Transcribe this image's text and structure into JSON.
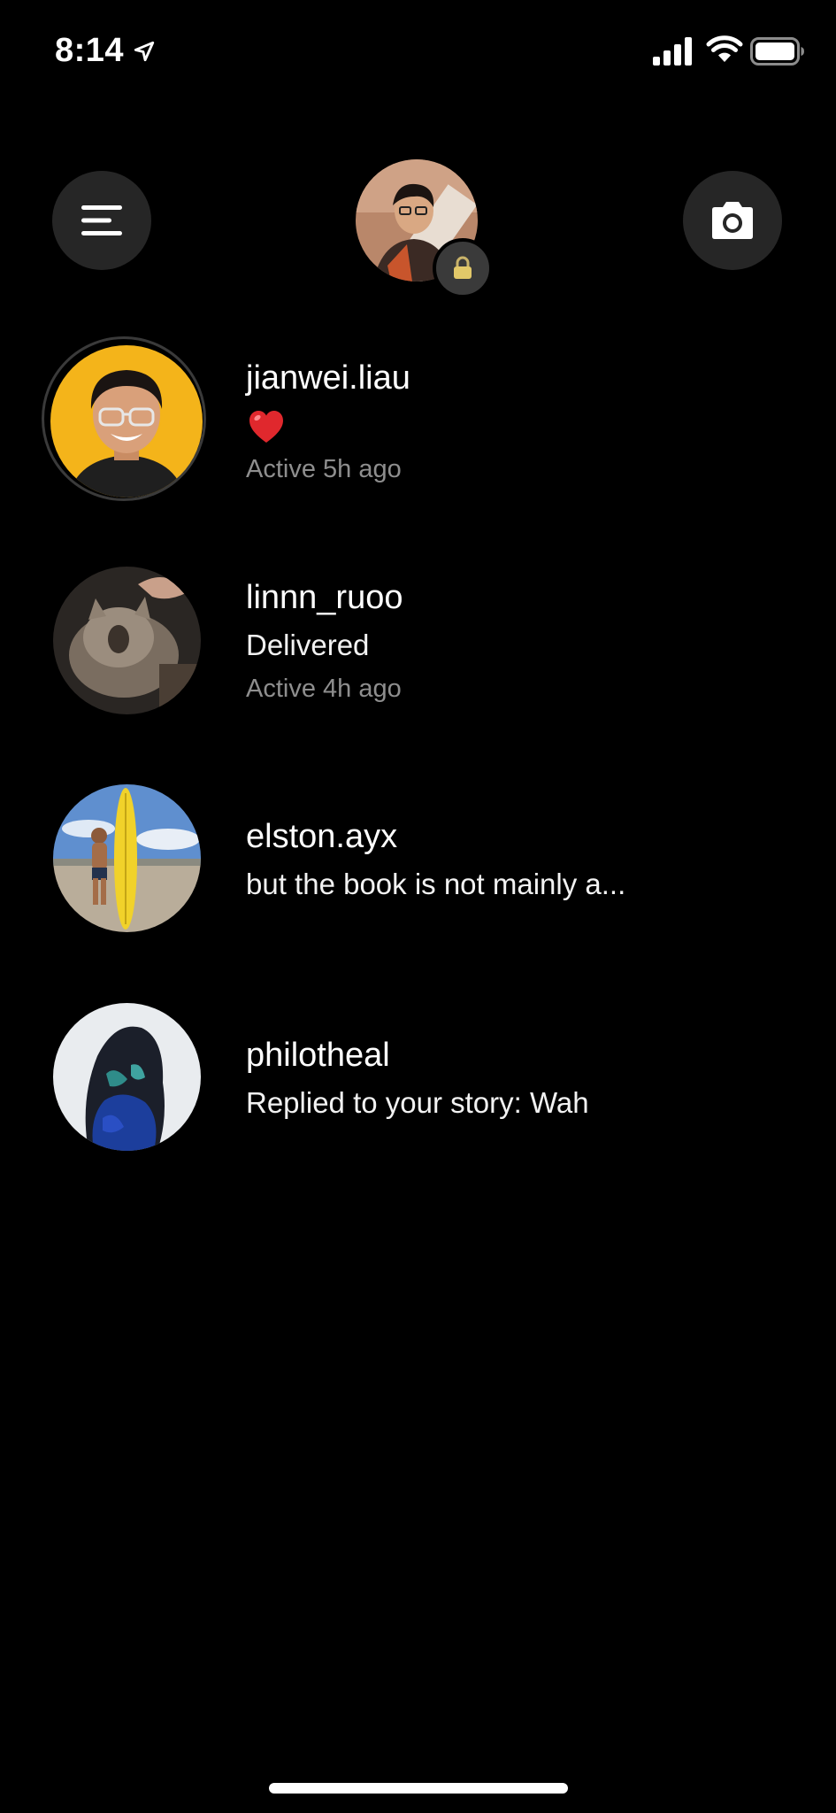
{
  "status_bar": {
    "time": "8:14",
    "icons": [
      "location-arrow-icon",
      "signal-icon",
      "wifi-icon",
      "battery-icon"
    ]
  },
  "header": {
    "menu_icon": "hamburger-menu-icon",
    "camera_icon": "camera-icon",
    "profile_badge_icon": "lock-icon"
  },
  "threads": [
    {
      "username": "jianwei.liau",
      "preview": "❤️",
      "preview_type": "heart-emoji",
      "active": "Active 5h ago",
      "has_story_ring": true
    },
    {
      "username": "linnn_ruoo",
      "preview": "Delivered",
      "active": "Active 4h ago",
      "has_story_ring": false
    },
    {
      "username": "elston.ayx",
      "preview": "but the book is not mainly a...",
      "active": "",
      "has_story_ring": false
    },
    {
      "username": "philotheal",
      "preview": "Replied to your story: Wah",
      "active": "",
      "has_story_ring": false
    }
  ],
  "colors": {
    "background": "#000000",
    "button_bg": "#262626",
    "secondary_text": "#8e8e8e",
    "heart": "#e0282d"
  }
}
